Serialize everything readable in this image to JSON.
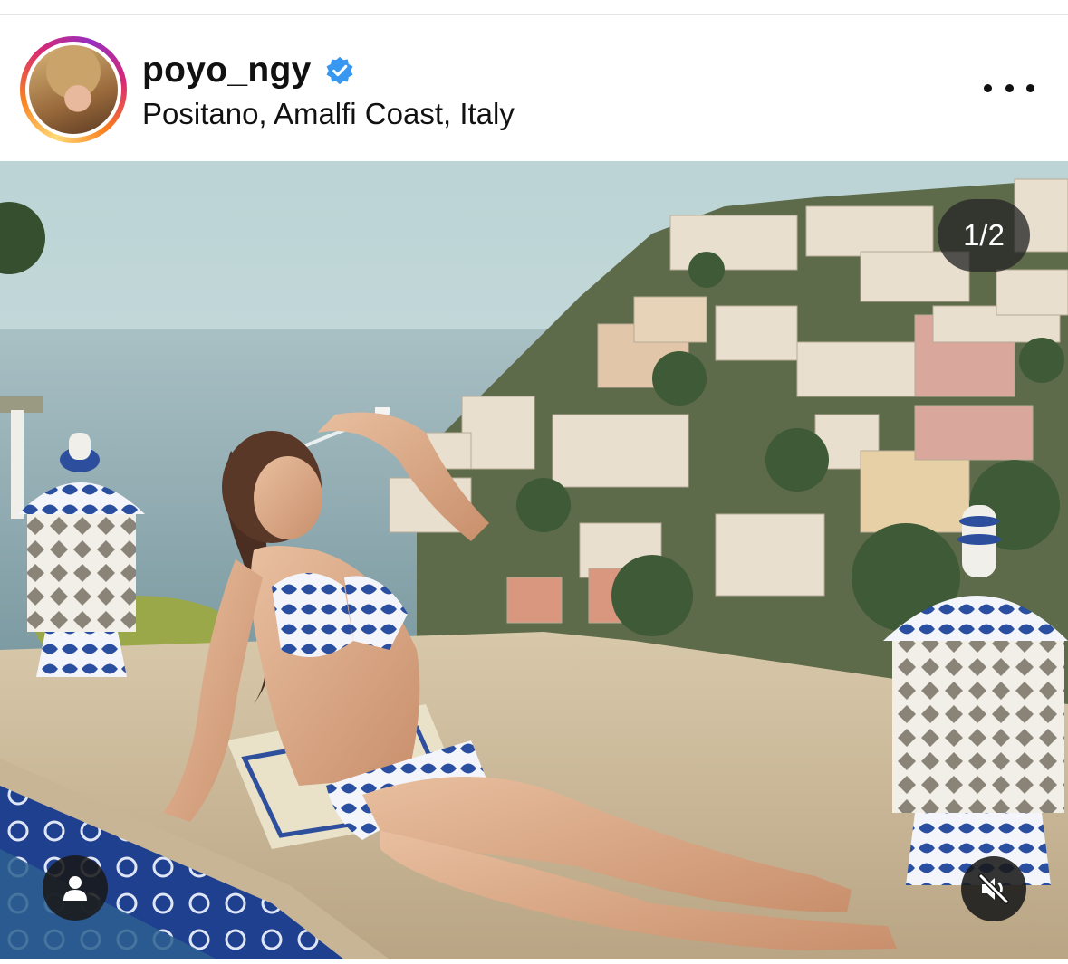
{
  "post": {
    "username": "poyo_ngy",
    "verified": true,
    "location": "Positano, Amalfi Coast, Italy",
    "image_counter": "1/2"
  },
  "icons": {
    "verified": "verified-badge-icon",
    "more": "more-options-icon",
    "tag": "tagged-user-icon",
    "mute": "sound-off-icon"
  },
  "colors": {
    "verified_blue": "#3897f0",
    "overlay_dark": "#191919"
  }
}
